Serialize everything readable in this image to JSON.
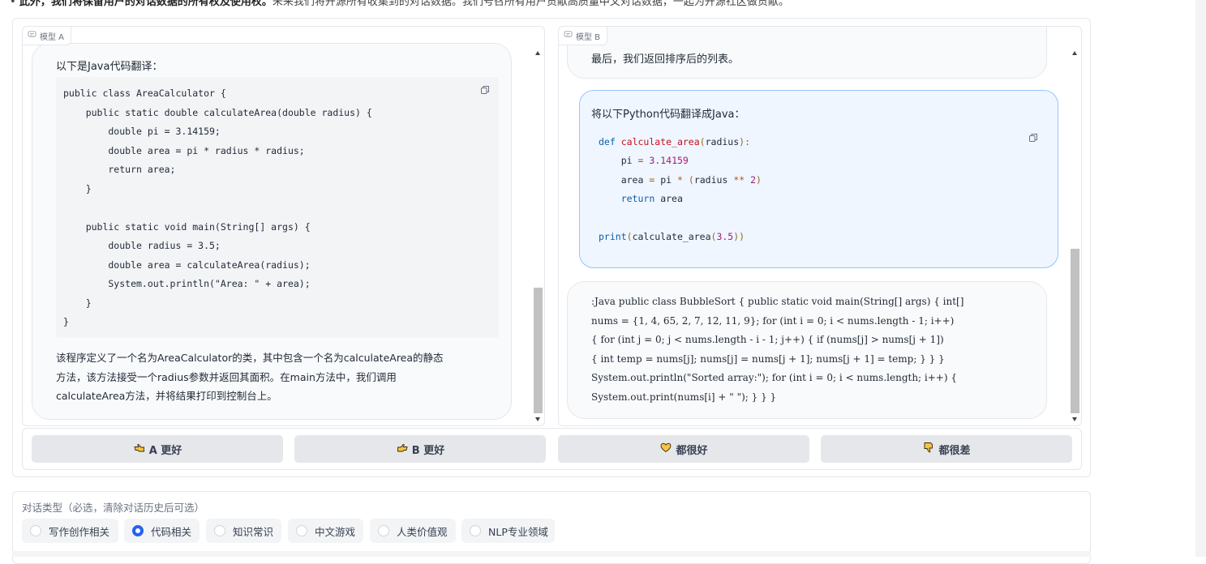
{
  "top_note": {
    "bold": "此外，我们将保留用户的对话数据的所有权及使用权。",
    "rest": "未来我们将开源所有收集到的对话数据。我们号召所有用户贡献高质量中文对话数据，一起为开源社区做贡献。"
  },
  "chat_a": {
    "label": "模型 A",
    "intro": "以下是Java代码翻译：",
    "code_lines": [
      "public class AreaCalculator {",
      "    public static double calculateArea(double radius) {",
      "        double pi = 3.14159;",
      "        double area = pi * radius * radius;",
      "        return area;",
      "    }",
      "",
      "    public static void main(String[] args) {",
      "        double radius = 3.5;",
      "        double area = calculateArea(radius);",
      "        System.out.println(\"Area: \" + area);",
      "    }",
      "}"
    ],
    "explanation": [
      "该程序定义了一个名为AreaCalculator的类，其中包含一个名为calculateArea的静态",
      "方法，该方法接受一个radius参数并返回其面积。在main方法中，我们调用",
      "calculateArea方法，并将结果打印到控制台上。"
    ]
  },
  "chat_b": {
    "label": "模型 B",
    "prev_tail": "最后，我们返回排序后的列表。",
    "user_prompt": "将以下Python代码翻译成Java：",
    "python": {
      "l1_kw": "def",
      "l1_fn": "calculate_area",
      "l1_paren_open": "(",
      "l1_arg": "radius",
      "l1_tail": "):",
      "l2_a": "pi",
      "l2_op": "=",
      "l2_num": "3.14159",
      "l3_a": "area",
      "l3_op": "=",
      "l3_b": "pi",
      "l3_mul": "*",
      "l3_paren_open": "(",
      "l3_c": "radius",
      "l3_pow": "**",
      "l3_num": "2",
      "l3_paren_close": ")",
      "l4_kw": "return",
      "l4_a": "area",
      "l6_kw": "print",
      "l6_paren": "(",
      "l6_fn": "calculate_area",
      "l6_paren2": "(",
      "l6_num": "3.5",
      "l6_tail": "))"
    },
    "answer_lines": [
      ":Java public class BubbleSort { public static void main(String[] args) { int[]",
      "nums = {1, 4, 65, 2, 7, 12, 11, 9}; for (int i = 0; i < nums.length - 1; i++)",
      "{ for (int j = 0; j < nums.length - i - 1; j++) { if (nums[j] > nums[j + 1])",
      "{ int temp = nums[j]; nums[j] = nums[j + 1]; nums[j + 1] = temp; } } }",
      "System.out.println(\"Sorted array:\"); for (int i = 0; i < nums.length; i++) {",
      "System.out.print(nums[i] + \" \"); } } }"
    ]
  },
  "votes": [
    {
      "label": "A 更好",
      "icon": "hand-left-icon"
    },
    {
      "label": "B 更好",
      "icon": "hand-right-icon"
    },
    {
      "label": "都很好",
      "icon": "heart-icon"
    },
    {
      "label": "都很差",
      "icon": "thumbs-down-icon"
    }
  ],
  "dialog_type": {
    "label": "对话类型（必选，清除对话历史后可选）",
    "options": [
      "写作创作相关",
      "代码相关",
      "知识常识",
      "中文游戏",
      "人类价值观",
      "NLP专业领域"
    ],
    "selected": "代码相关"
  },
  "colors": {
    "accent": "#2563eb",
    "user_bubble": "#eff6ff",
    "user_border": "#93c5fd",
    "button_bg": "#e5e7eb"
  }
}
